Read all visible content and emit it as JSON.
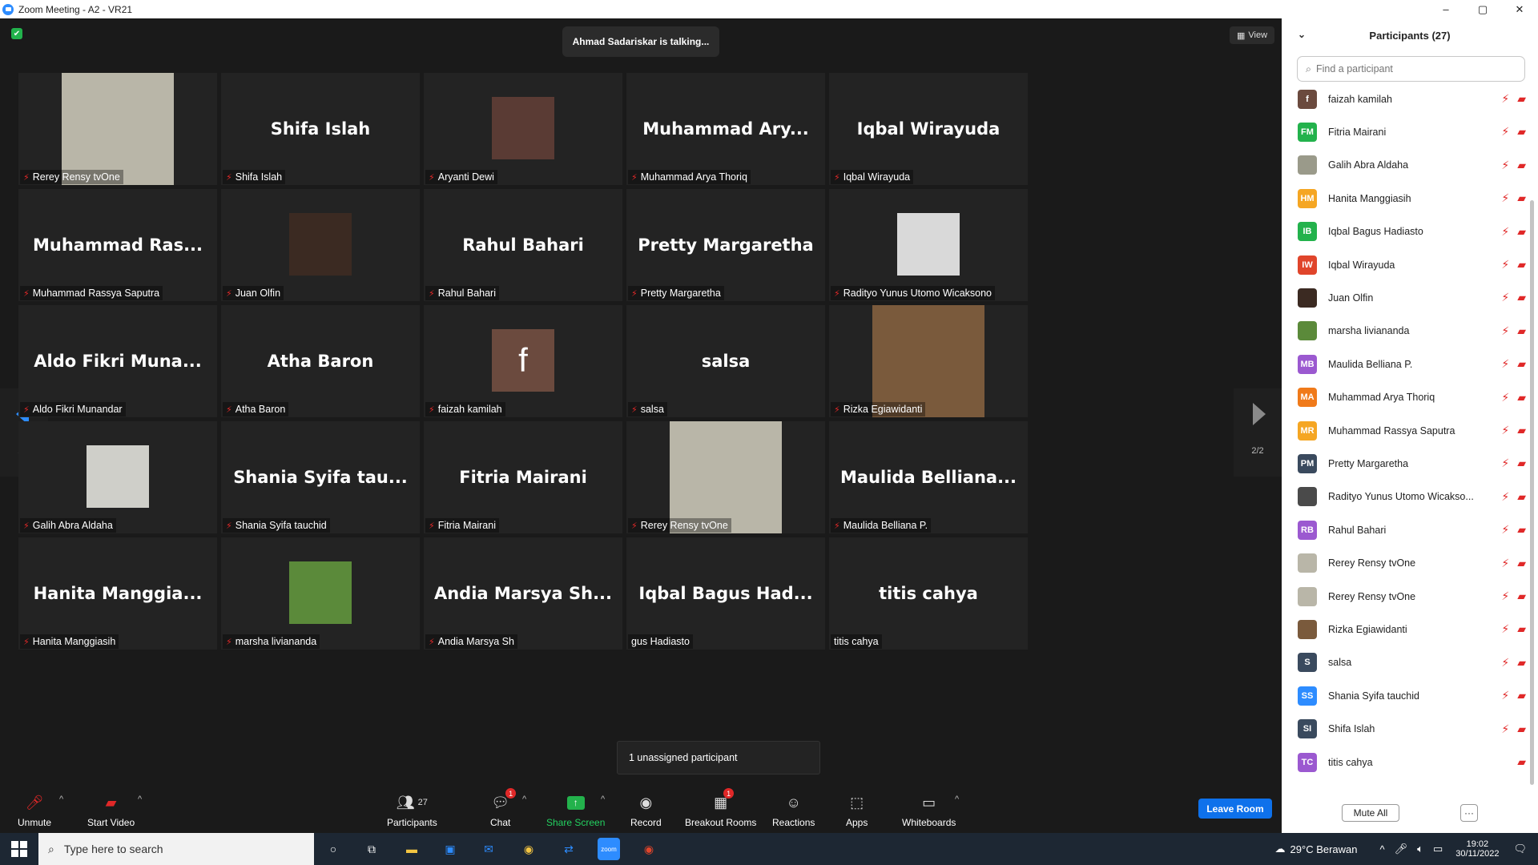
{
  "window": {
    "title": "Zoom Meeting - A2 - VR21",
    "controls": [
      "–",
      "▢",
      "✕"
    ]
  },
  "meeting": {
    "talking_text": "Ahmad Sadariskar is talking...",
    "view_label": "View",
    "page_indicator_left": "2/2",
    "page_indicator_right": "2/2",
    "tooltip": "1 unassigned participant"
  },
  "tiles": [
    {
      "big": "",
      "label": "Rerey Rensy tvOne",
      "photo": "woman-hijab-glasses",
      "photo_color": "#b9b6a8",
      "muted": true
    },
    {
      "big": "Shifa Islah",
      "label": "Shifa Islah",
      "muted": true
    },
    {
      "big": "",
      "label": "Aryanti Dewi",
      "photo": "woman-sunglasses",
      "photo_color": "#5a3b34",
      "muted": true
    },
    {
      "big": "Muhammad Ary...",
      "label": "Muhammad Arya Thoriq",
      "muted": true
    },
    {
      "big": "Iqbal Wirayuda",
      "label": "Iqbal Wirayuda",
      "muted": true
    },
    {
      "big": "Muhammad Ras...",
      "label": "Muhammad Rassya Saputra",
      "muted": true
    },
    {
      "big": "",
      "label": "Juan Olfin",
      "photo": "man-face-closeup",
      "photo_color": "#3b2a22",
      "muted": true
    },
    {
      "big": "Rahul Bahari",
      "label": "Rahul Bahari",
      "muted": true
    },
    {
      "big": "Pretty Margaretha",
      "label": "Pretty Margaretha",
      "muted": true
    },
    {
      "big": "",
      "label": "Radityo Yunus Utomo Wicaksono",
      "photo": "young-man-portrait",
      "photo_color": "#d9d9d9",
      "muted": true
    },
    {
      "big": "Aldo Fikri Muna...",
      "label": "Aldo Fikri Munandar",
      "muted": true
    },
    {
      "big": "Atha Baron",
      "label": "Atha Baron",
      "muted": true
    },
    {
      "big": "",
      "label": "faizah kamilah",
      "photo": "letter-f-avatar",
      "photo_color": "#6b4a3e",
      "photo_letter": "f",
      "muted": true
    },
    {
      "big": "salsa",
      "label": "salsa",
      "muted": true
    },
    {
      "big": "",
      "label": "Rizka Egiawidanti",
      "photo": "woman-lying-hijab",
      "photo_color": "#7a5a3c",
      "muted": true
    },
    {
      "big": "",
      "label": "Galih Abra Aldaha",
      "photo": "man-drinking",
      "photo_color": "#cfcfc9",
      "muted": true
    },
    {
      "big": "Shania Syifa tau...",
      "label": "Shania Syifa tauchid",
      "muted": true
    },
    {
      "big": "Fitria Mairani",
      "label": "Fitria Mairani",
      "muted": true
    },
    {
      "big": "",
      "label": "Rerey Rensy tvOne",
      "photo": "woman-hijab-glasses",
      "photo_color": "#b9b6a8",
      "muted": true
    },
    {
      "big": "Maulida Belliana...",
      "label": "Maulida Belliana P.",
      "muted": true
    },
    {
      "big": "Hanita Manggia...",
      "label": "Hanita Manggiasih",
      "muted": true
    },
    {
      "big": "",
      "label": "marsha liviananda",
      "photo": "woman-on-grass",
      "photo_color": "#5b8a3a",
      "muted": true
    },
    {
      "big": "Andia Marsya Sh...",
      "label": "Andia Marsya Sh",
      "muted": true
    },
    {
      "big": "Iqbal Bagus Had...",
      "label": "gus Hadiasto",
      "muted": false
    },
    {
      "big": "titis cahya",
      "label": "titis cahya",
      "muted": false
    }
  ],
  "toolbar": {
    "unmute": "Unmute",
    "start_video": "Start Video",
    "participants": "Participants",
    "participants_count": "27",
    "chat": "Chat",
    "chat_badge": "1",
    "share_screen": "Share Screen",
    "record": "Record",
    "breakout_rooms": "Breakout Rooms",
    "breakout_badge": "1",
    "reactions": "Reactions",
    "apps": "Apps",
    "whiteboards": "Whiteboards",
    "leave_room": "Leave Room"
  },
  "panel": {
    "title": "Participants (27)",
    "search_placeholder": "Find a participant",
    "mute_all": "Mute All",
    "more": "···",
    "participants": [
      {
        "name": "faizah kamilah",
        "initials": "f",
        "color": "#6b4a3e",
        "video_off": true
      },
      {
        "name": "Fitria Mairani",
        "initials": "FM",
        "color": "#23b24c",
        "video_off": true
      },
      {
        "name": "Galih Abra Aldaha",
        "initials": "",
        "color": "#9a9a8a",
        "video_off": true
      },
      {
        "name": "Hanita Manggiasih",
        "initials": "HM",
        "color": "#f5a623",
        "video_off": true
      },
      {
        "name": "Iqbal Bagus Hadiasto",
        "initials": "IB",
        "color": "#23b24c",
        "video_off": true
      },
      {
        "name": "Iqbal Wirayuda",
        "initials": "IW",
        "color": "#e0452b",
        "video_off": true
      },
      {
        "name": "Juan Olfin",
        "initials": "",
        "color": "#3b2a22",
        "video_off": true
      },
      {
        "name": "marsha liviananda",
        "initials": "",
        "color": "#5b8a3a",
        "video_off": true
      },
      {
        "name": "Maulida Belliana P.",
        "initials": "MB",
        "color": "#9b59d0",
        "video_off": true
      },
      {
        "name": "Muhammad Arya Thoriq",
        "initials": "MA",
        "color": "#f07a1a",
        "video_off": true
      },
      {
        "name": "Muhammad Rassya Saputra",
        "initials": "MR",
        "color": "#f5a623",
        "video_off": true
      },
      {
        "name": "Pretty Margaretha",
        "initials": "PM",
        "color": "#3a4a5e",
        "video_off": true
      },
      {
        "name": "Radityo Yunus Utomo Wicakso...",
        "initials": "",
        "color": "#4a4a4a",
        "video_off": true
      },
      {
        "name": "Rahul Bahari",
        "initials": "RB",
        "color": "#9b59d0",
        "video_off": true
      },
      {
        "name": "Rerey Rensy tvOne",
        "initials": "",
        "color": "#b9b6a8",
        "video_off": true
      },
      {
        "name": "Rerey Rensy tvOne",
        "initials": "",
        "color": "#b9b6a8",
        "video_off": true
      },
      {
        "name": "Rizka Egiawidanti",
        "initials": "",
        "color": "#7a5a3c",
        "video_off": true
      },
      {
        "name": "salsa",
        "initials": "S",
        "color": "#3a4a5e",
        "video_off": true
      },
      {
        "name": "Shania Syifa tauchid",
        "initials": "SS",
        "color": "#2d8cff",
        "video_off": true
      },
      {
        "name": "Shifa Islah",
        "initials": "SI",
        "color": "#3a4a5e",
        "video_off": true
      },
      {
        "name": "titis cahya",
        "initials": "TC",
        "color": "#9b59d0",
        "video_off": true,
        "mic_hidden": true
      }
    ]
  },
  "taskbar": {
    "search_placeholder": "Type here to search",
    "weather": "29°C  Berawan",
    "time": "19:02",
    "date": "30/11/2022"
  }
}
